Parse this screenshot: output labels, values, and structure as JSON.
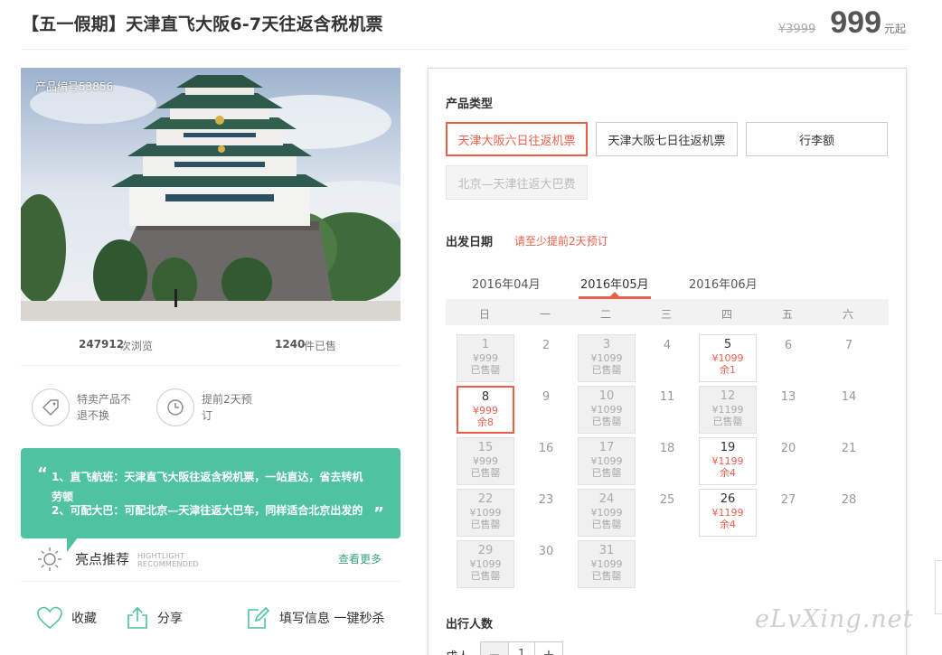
{
  "product": {
    "title": "【五一假期】天津直飞大阪6-7天往返含税机票",
    "old_price": "¥3999",
    "price": "999",
    "price_unit": "元起",
    "code": "产品编号53856"
  },
  "stats": {
    "views_value": "247912",
    "views_label": "次浏览",
    "sold_value": "1240",
    "sold_label": "件已售"
  },
  "features": [
    {
      "icon": "tag-icon",
      "text": "特卖产品不退不换"
    },
    {
      "icon": "clock-icon",
      "text": "提前2天预订"
    }
  ],
  "highlights": {
    "line1": "1、直飞航班：天津直飞大阪往返含税机票，一站直达，省去转机劳顿",
    "line2": "2、可配大巴：可配北京—天津往返大巴车，同样适合北京出发的",
    "title": "亮点推荐",
    "en_line1": "HIGHTLIGHT",
    "en_line2": "RECOMMENDED",
    "more": "查看更多",
    "accent": "#4fc3a1"
  },
  "actions": {
    "favorite": "收藏",
    "share": "分享",
    "fill": "填写信息 一键秒杀"
  },
  "booking": {
    "type_label": "产品类型",
    "types": [
      {
        "label": "天津大阪六日往返机票",
        "state": "selected"
      },
      {
        "label": "天津大阪七日往返机票",
        "state": "normal"
      },
      {
        "label": "行李额",
        "state": "normal"
      },
      {
        "label": "北京—天津往返大巴费",
        "state": "disabled"
      }
    ],
    "date_label": "出发日期",
    "date_tip": "请至少提前2天预订",
    "months": [
      "2016年04月",
      "2016年05月",
      "2016年06月"
    ],
    "active_month": "2016年05月",
    "weekdays": [
      "日",
      "一",
      "二",
      "三",
      "四",
      "五",
      "六"
    ],
    "days": [
      {
        "day": "1",
        "price": "¥999",
        "status": "已售罄",
        "state": "sold"
      },
      {
        "day": "2",
        "state": "plain"
      },
      {
        "day": "3",
        "price": "¥1099",
        "status": "已售罄",
        "state": "sold"
      },
      {
        "day": "4",
        "state": "plain"
      },
      {
        "day": "5",
        "price": "¥1099",
        "status": "余1",
        "state": "avail"
      },
      {
        "day": "6",
        "state": "plain"
      },
      {
        "day": "7",
        "state": "plain"
      },
      {
        "day": "8",
        "price": "¥999",
        "status": "余8",
        "state": "sel"
      },
      {
        "day": "9",
        "state": "plain"
      },
      {
        "day": "10",
        "price": "¥1099",
        "status": "已售罄",
        "state": "sold"
      },
      {
        "day": "11",
        "state": "plain"
      },
      {
        "day": "12",
        "price": "¥1199",
        "status": "已售罄",
        "state": "sold"
      },
      {
        "day": "13",
        "state": "plain"
      },
      {
        "day": "14",
        "state": "plain"
      },
      {
        "day": "15",
        "price": "¥999",
        "status": "已售罄",
        "state": "sold"
      },
      {
        "day": "16",
        "state": "plain"
      },
      {
        "day": "17",
        "price": "¥1099",
        "status": "已售罄",
        "state": "sold"
      },
      {
        "day": "18",
        "state": "plain"
      },
      {
        "day": "19",
        "price": "¥1199",
        "status": "余4",
        "state": "avail"
      },
      {
        "day": "20",
        "state": "plain"
      },
      {
        "day": "21",
        "state": "plain"
      },
      {
        "day": "22",
        "price": "¥1099",
        "status": "已售罄",
        "state": "sold"
      },
      {
        "day": "23",
        "state": "plain"
      },
      {
        "day": "24",
        "price": "¥1099",
        "status": "已售罄",
        "state": "sold"
      },
      {
        "day": "25",
        "state": "plain"
      },
      {
        "day": "26",
        "price": "¥1199",
        "status": "余4",
        "state": "avail"
      },
      {
        "day": "27",
        "state": "plain"
      },
      {
        "day": "28",
        "state": "plain"
      },
      {
        "day": "29",
        "price": "¥1099",
        "status": "已售罄",
        "state": "sold"
      },
      {
        "day": "30",
        "state": "plain"
      },
      {
        "day": "31",
        "price": "¥1099",
        "status": "已售罄",
        "state": "sold"
      }
    ],
    "people_label": "出行人数",
    "adult_label": "成人",
    "minus": "−",
    "plus": "+",
    "quantity": "1",
    "accent": "#e8604c"
  },
  "watermark": "eLvXing.net"
}
